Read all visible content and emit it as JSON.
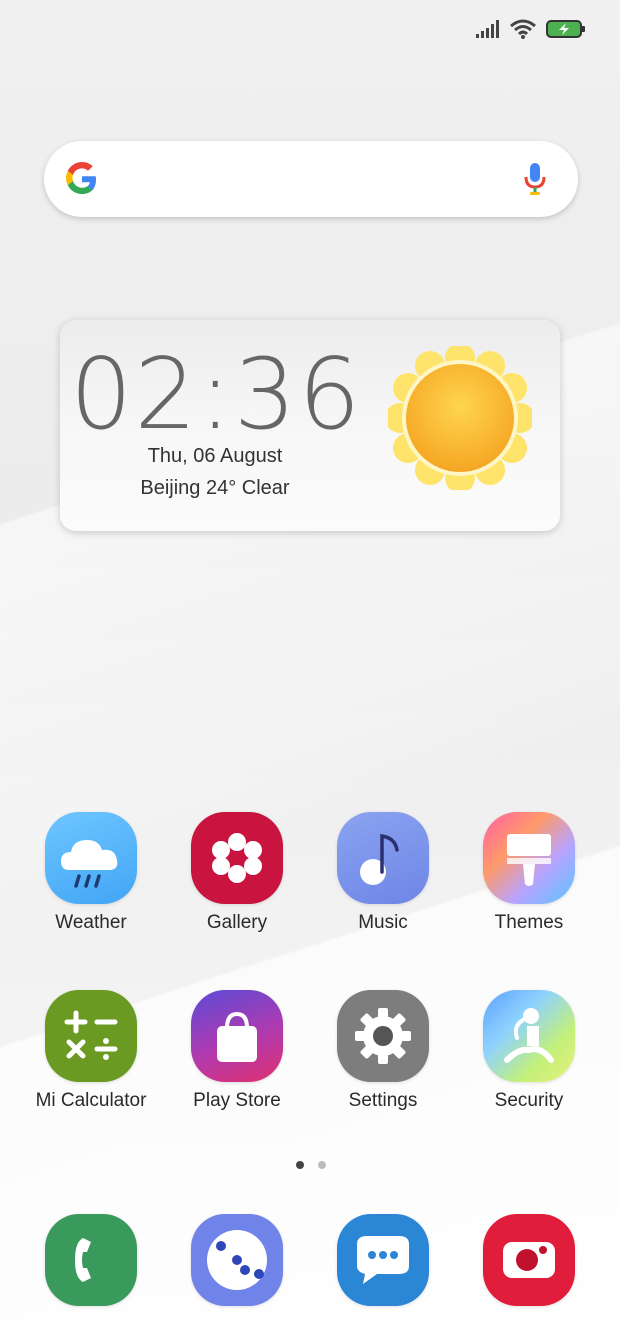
{
  "clock": {
    "time": "02:36",
    "date": "Thu, 06 August",
    "weather": "Beijing 24° Clear",
    "weather_icon": "sun-icon"
  },
  "search": {
    "logo": "google-g-icon",
    "voice_icon": "mic-icon"
  },
  "status_bar": {
    "icons": [
      "signal-icon",
      "wifi-icon",
      "battery-charging-icon"
    ],
    "battery_color": "#4caf50"
  },
  "apps": [
    {
      "label": "Weather",
      "icon": "weather-icon"
    },
    {
      "label": "Gallery",
      "icon": "gallery-icon"
    },
    {
      "label": "Music",
      "icon": "music-icon"
    },
    {
      "label": "Themes",
      "icon": "themes-icon"
    },
    {
      "label": "Mi Calculator",
      "icon": "calculator-icon"
    },
    {
      "label": "Play Store",
      "icon": "play-store-icon"
    },
    {
      "label": "Settings",
      "icon": "settings-icon"
    },
    {
      "label": "Security",
      "icon": "security-icon"
    }
  ],
  "dock": [
    {
      "icon": "phone-icon",
      "color": "#3a9a5c"
    },
    {
      "icon": "browser-icon",
      "color": "#6f83e8"
    },
    {
      "icon": "messaging-icon",
      "color": "#2b86d6"
    },
    {
      "icon": "camera-icon",
      "color": "#e01e3c"
    }
  ],
  "page_indicator": {
    "pages": 2,
    "current": 1
  }
}
